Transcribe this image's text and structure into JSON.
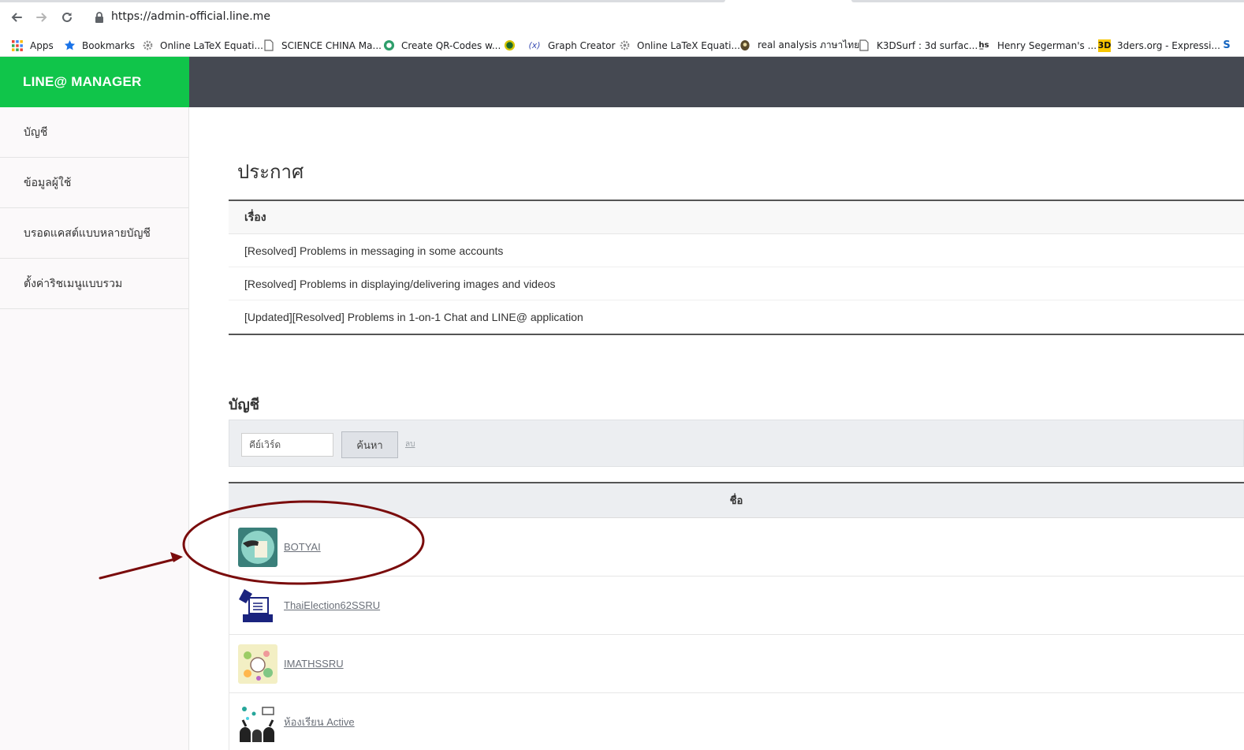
{
  "browser": {
    "url": "https://admin-official.line.me",
    "bookmarks": [
      {
        "label": "Apps",
        "icon": "apps-grid-icon"
      },
      {
        "label": "Bookmarks",
        "icon": "star-icon"
      },
      {
        "label": "Online LaTeX Equati...",
        "icon": "gear-favicon-icon"
      },
      {
        "label": "SCIENCE CHINA Ma...",
        "icon": "page-icon"
      },
      {
        "label": "Create QR-Codes w...",
        "icon": "qr-favicon-icon"
      },
      {
        "label": "",
        "icon": "green-circle-favicon-icon"
      },
      {
        "label": "Graph Creator",
        "icon": "fx-favicon-icon"
      },
      {
        "label": "Online LaTeX Equati...",
        "icon": "gear-favicon-icon"
      },
      {
        "label": "real analysis ภาษาไทย",
        "icon": "dark-favicon-icon"
      },
      {
        "label": "K3DSurf : 3d surfac...",
        "icon": "page-icon"
      },
      {
        "label": "Henry Segerman's ...",
        "icon": "hs-favicon-icon"
      },
      {
        "label": "3ders.org - Expressi...",
        "icon": "3d-favicon-icon"
      },
      {
        "label": "",
        "icon": "s-favicon-icon"
      }
    ]
  },
  "header": {
    "brand": "LINE@ MANAGER",
    "brand_color": "#10c54a",
    "bar_color": "#454952"
  },
  "sidebar": {
    "items": [
      {
        "label": "บัญชี"
      },
      {
        "label": "ข้อมูลผู้ใช้"
      },
      {
        "label": "บรอดแคสต์แบบหลายบัญชี"
      },
      {
        "label": "ตั้งค่าริชเมนูแบบรวม"
      }
    ]
  },
  "announcements": {
    "title": "ประกาศ",
    "column": "เรื่อง",
    "rows": [
      "[Resolved] Problems in messaging in some accounts",
      "[Resolved] Problems in displaying/delivering images and videos",
      "[Updated][Resolved] Problems in 1-on-1 Chat and LINE@ application"
    ]
  },
  "accounts": {
    "title": "บัญชี",
    "search_placeholder": "คีย์เวิร์ด",
    "search_button": "ค้นหา",
    "clear_link": "ลบ",
    "column": "ชื่อ",
    "rows": [
      {
        "name": "BOTYAI",
        "avatar": "hand-card-avatar"
      },
      {
        "name": "ThaiElection62SSRU",
        "avatar": "ballot-box-avatar"
      },
      {
        "name": "IMATHSSRU",
        "avatar": "collage-avatar"
      },
      {
        "name": "ห้องเรียน Active",
        "avatar": "classroom-avatar"
      }
    ]
  },
  "annotation": {
    "color": "#7a0c0c"
  }
}
